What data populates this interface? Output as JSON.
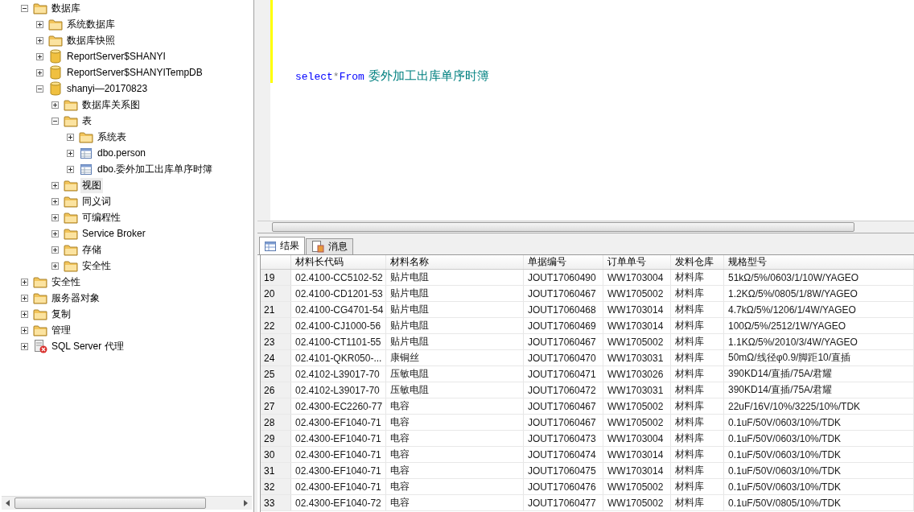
{
  "tree": [
    {
      "label": "数据库",
      "kind": "folder",
      "expanded": true,
      "selected": false,
      "children": [
        {
          "label": "系统数据库",
          "kind": "folder",
          "expanded": false,
          "selected": false
        },
        {
          "label": "数据库快照",
          "kind": "folder",
          "expanded": false,
          "selected": false
        },
        {
          "label": "ReportServer$SHANYI",
          "kind": "database",
          "expanded": false,
          "selected": false
        },
        {
          "label": "ReportServer$SHANYITempDB",
          "kind": "database",
          "expanded": false,
          "selected": false
        },
        {
          "label": "shanyi—20170823",
          "kind": "database",
          "expanded": true,
          "selected": false,
          "children": [
            {
              "label": "数据库关系图",
              "kind": "folder",
              "expanded": false,
              "selected": false
            },
            {
              "label": "表",
              "kind": "folder",
              "expanded": true,
              "selected": false,
              "children": [
                {
                  "label": "系统表",
                  "kind": "folder",
                  "expanded": false,
                  "selected": false
                },
                {
                  "label": "dbo.person",
                  "kind": "table",
                  "expanded": false,
                  "selected": false
                },
                {
                  "label": "dbo.委外加工出库单序时簿",
                  "kind": "table",
                  "expanded": false,
                  "selected": false
                }
              ]
            },
            {
              "label": "视图",
              "kind": "folder",
              "expanded": false,
              "selected": true
            },
            {
              "label": "同义词",
              "kind": "folder",
              "expanded": false,
              "selected": false
            },
            {
              "label": "可编程性",
              "kind": "folder",
              "expanded": false,
              "selected": false
            },
            {
              "label": "Service Broker",
              "kind": "folder",
              "expanded": false,
              "selected": false
            },
            {
              "label": "存储",
              "kind": "folder",
              "expanded": false,
              "selected": false
            },
            {
              "label": "安全性",
              "kind": "folder",
              "expanded": false,
              "selected": false
            }
          ]
        }
      ]
    },
    {
      "label": "安全性",
      "kind": "folder",
      "expanded": false,
      "selected": false
    },
    {
      "label": "服务器对象",
      "kind": "folder",
      "expanded": false,
      "selected": false
    },
    {
      "label": "复制",
      "kind": "folder",
      "expanded": false,
      "selected": false
    },
    {
      "label": "管理",
      "kind": "folder",
      "expanded": false,
      "selected": false
    },
    {
      "label": "SQL Server 代理",
      "kind": "agent",
      "expanded": false,
      "selected": false
    }
  ],
  "editor": {
    "tokens": [
      {
        "kind": "keyword",
        "text": "select"
      },
      {
        "kind": "operator",
        "text": "*"
      },
      {
        "kind": "keyword",
        "text": "From"
      },
      {
        "kind": "identifier",
        "text": " 委外加工出库单序时簿"
      }
    ]
  },
  "result_tabs": [
    {
      "label": "结果",
      "kind": "results",
      "selected": true
    },
    {
      "label": "消息",
      "kind": "messages",
      "selected": false
    }
  ],
  "grid": {
    "columns": [
      "材料长代码",
      "材料名称",
      "单据编号",
      "订单单号",
      "发料仓库",
      "规格型号"
    ],
    "rows": [
      {
        "number": "19",
        "cells": [
          "02.4100-CC5102-52",
          "贴片电阻",
          "JOUT17060490",
          "WW1703004",
          "材料库",
          "51kΩ/5%/0603/1/10W/YAGEO"
        ]
      },
      {
        "number": "20",
        "cells": [
          "02.4100-CD1201-53",
          "贴片电阻",
          "JOUT17060467",
          "WW1705002",
          "材料库",
          "1.2KΩ/5%/0805/1/8W/YAGEO"
        ]
      },
      {
        "number": "21",
        "cells": [
          "02.4100-CG4701-54",
          "贴片电阻",
          "JOUT17060468",
          "WW1703014",
          "材料库",
          "4.7kΩ/5%/1206/1/4W/YAGEO"
        ]
      },
      {
        "number": "22",
        "cells": [
          "02.4100-CJ1000-56",
          "贴片电阻",
          "JOUT17060469",
          "WW1703014",
          "材料库",
          "100Ω/5%/2512/1W/YAGEO"
        ]
      },
      {
        "number": "23",
        "cells": [
          "02.4100-CT1101-55",
          "贴片电阻",
          "JOUT17060467",
          "WW1705002",
          "材料库",
          "1.1KΩ/5%/2010/3/4W/YAGEO"
        ]
      },
      {
        "number": "24",
        "cells": [
          "02.4101-QKR050-...",
          "康铜丝",
          "JOUT17060470",
          "WW1703031",
          "材料库",
          "50mΩ/线径φ0.9/脚距10/直插"
        ]
      },
      {
        "number": "25",
        "cells": [
          "02.4102-L39017-70",
          "压敏电阻",
          "JOUT17060471",
          "WW1703026",
          "材料库",
          "390KD14/直插/75A/君耀"
        ]
      },
      {
        "number": "26",
        "cells": [
          "02.4102-L39017-70",
          "压敏电阻",
          "JOUT17060472",
          "WW1703031",
          "材料库",
          "390KD14/直插/75A/君耀"
        ]
      },
      {
        "number": "27",
        "cells": [
          "02.4300-EC2260-77",
          "电容",
          "JOUT17060467",
          "WW1705002",
          "材料库",
          "22uF/16V/10%/3225/10%/TDK"
        ]
      },
      {
        "number": "28",
        "cells": [
          "02.4300-EF1040-71",
          "电容",
          "JOUT17060467",
          "WW1705002",
          "材料库",
          "0.1uF/50V/0603/10%/TDK"
        ]
      },
      {
        "number": "29",
        "cells": [
          "02.4300-EF1040-71",
          "电容",
          "JOUT17060473",
          "WW1703004",
          "材料库",
          "0.1uF/50V/0603/10%/TDK"
        ]
      },
      {
        "number": "30",
        "cells": [
          "02.4300-EF1040-71",
          "电容",
          "JOUT17060474",
          "WW1703014",
          "材料库",
          "0.1uF/50V/0603/10%/TDK"
        ]
      },
      {
        "number": "31",
        "cells": [
          "02.4300-EF1040-71",
          "电容",
          "JOUT17060475",
          "WW1703014",
          "材料库",
          "0.1uF/50V/0603/10%/TDK"
        ]
      },
      {
        "number": "32",
        "cells": [
          "02.4300-EF1040-71",
          "电容",
          "JOUT17060476",
          "WW1705002",
          "材料库",
          "0.1uF/50V/0603/10%/TDK"
        ]
      },
      {
        "number": "33",
        "cells": [
          "02.4300-EF1040-72",
          "电容",
          "JOUT17060477",
          "WW1705002",
          "材料库",
          "0.1uF/50V/0805/10%/TDK"
        ]
      }
    ]
  }
}
